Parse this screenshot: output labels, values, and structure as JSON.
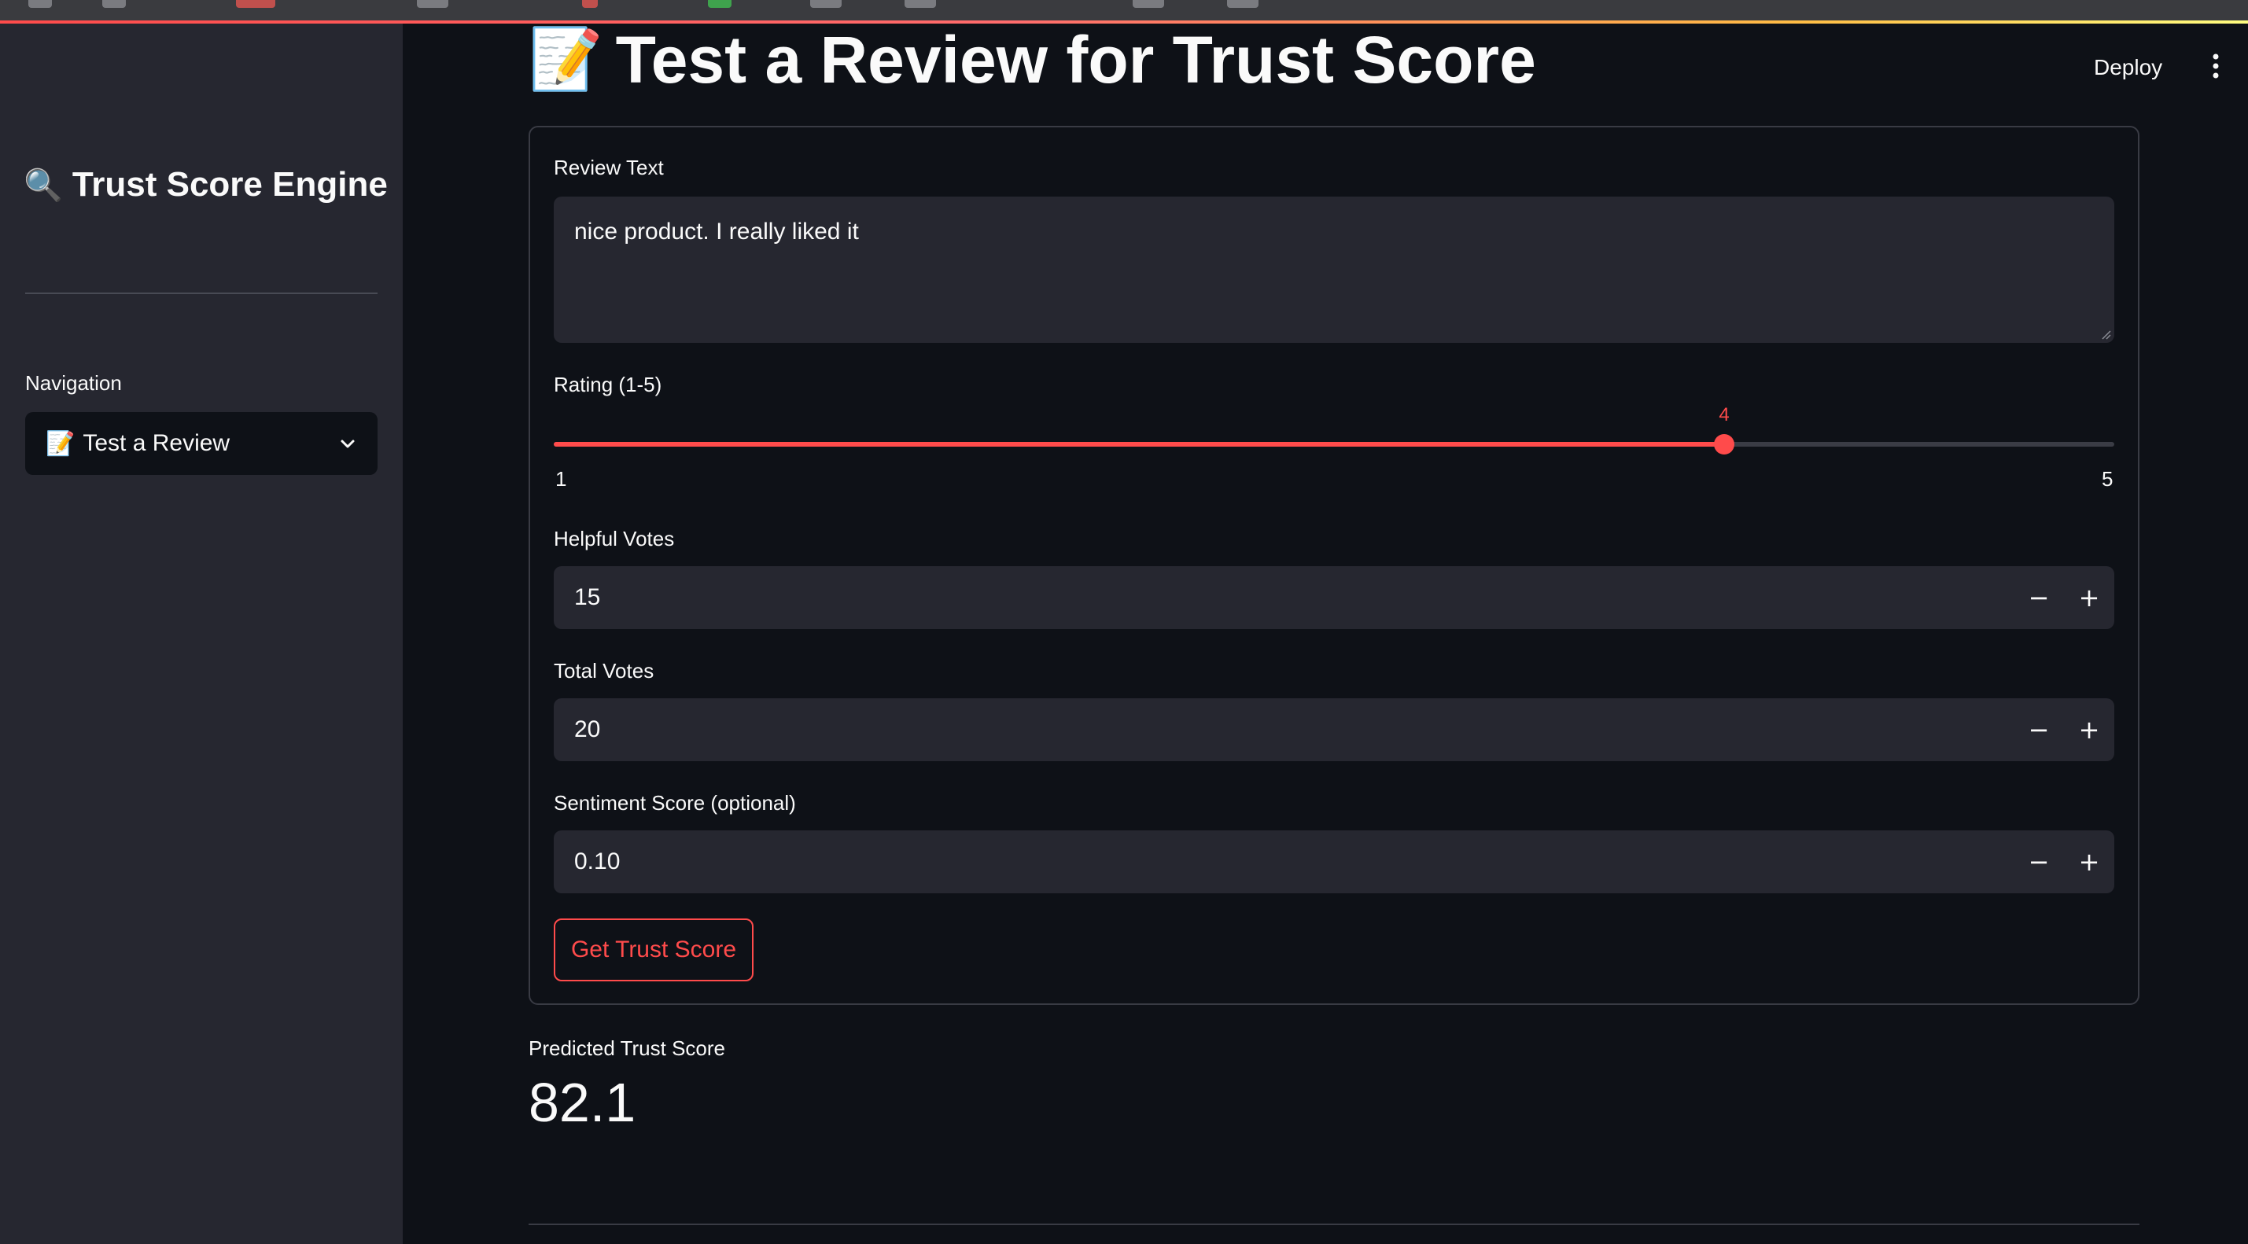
{
  "sidebar": {
    "title": "Trust Score Engine",
    "title_icon": "magnifier-icon",
    "nav_label": "Navigation",
    "nav_selected": "Test a Review",
    "nav_icon": "memo-icon"
  },
  "header": {
    "title": "Test a Review for Trust Score",
    "title_icon": "memo-icon",
    "deploy_label": "Deploy"
  },
  "form": {
    "review_text_label": "Review Text",
    "review_text_value": "nice product. I really liked it",
    "rating": {
      "label": "Rating (1-5)",
      "value": 4,
      "min": 1,
      "max": 5,
      "value_label": "4",
      "min_label": "1",
      "max_label": "5"
    },
    "helpful_votes_label": "Helpful Votes",
    "helpful_votes_value": "15",
    "total_votes_label": "Total Votes",
    "total_votes_value": "20",
    "sentiment_label": "Sentiment Score (optional)",
    "sentiment_value": "0.10",
    "submit_label": "Get Trust Score",
    "stepper_minus": "−",
    "stepper_plus": "+"
  },
  "result": {
    "label": "Predicted Trust Score",
    "value": "82.1"
  },
  "colors": {
    "background": "#0e1117",
    "sidebar": "#262730",
    "accent": "#ff4b4b",
    "input_bg": "#262730"
  }
}
